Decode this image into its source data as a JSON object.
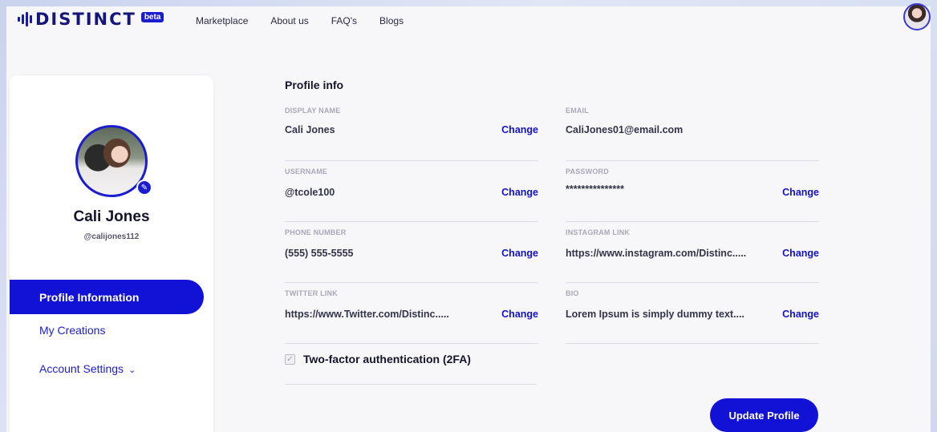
{
  "header": {
    "logo_text": "DISTINCT",
    "logo_badge": "beta",
    "nav": [
      {
        "label": "Marketplace"
      },
      {
        "label": "About us"
      },
      {
        "label": "FAQ's"
      },
      {
        "label": "Blogs"
      }
    ]
  },
  "sidebar": {
    "name": "Cali Jones",
    "handle": "@calijones112",
    "menu": {
      "active": "Profile Information",
      "creations": "My Creations",
      "account_settings": "Account Settings"
    }
  },
  "profile": {
    "section_title": "Profile info",
    "change_label": "Change",
    "fields": {
      "display_name": {
        "label": "DISPLAY NAME",
        "value": "Cali Jones"
      },
      "email": {
        "label": "EMAIL",
        "value": "CaliJones01@email.com"
      },
      "username": {
        "label": "USERNAME",
        "value": "@tcole100"
      },
      "password": {
        "label": "PASSWORD",
        "value": "***************"
      },
      "phone": {
        "label": "PHONE NUMBER",
        "value": "(555) 555-5555"
      },
      "instagram": {
        "label": "INSTAGRAM LINK",
        "value": "https://www.instagram.com/Distinc....."
      },
      "twitter": {
        "label": "TWITTER LINK",
        "value": "https://www.Twitter.com/Distinc....."
      },
      "bio": {
        "label": "BIO",
        "value": "Lorem Ipsum is simply dummy text...."
      }
    },
    "two_factor": {
      "label": "Two-factor authentication (2FA)",
      "checked": true
    },
    "update_button": "Update Profile"
  },
  "colors": {
    "accent": "#1212d6",
    "text": "#14142b",
    "muted": "#a8a8b8"
  }
}
